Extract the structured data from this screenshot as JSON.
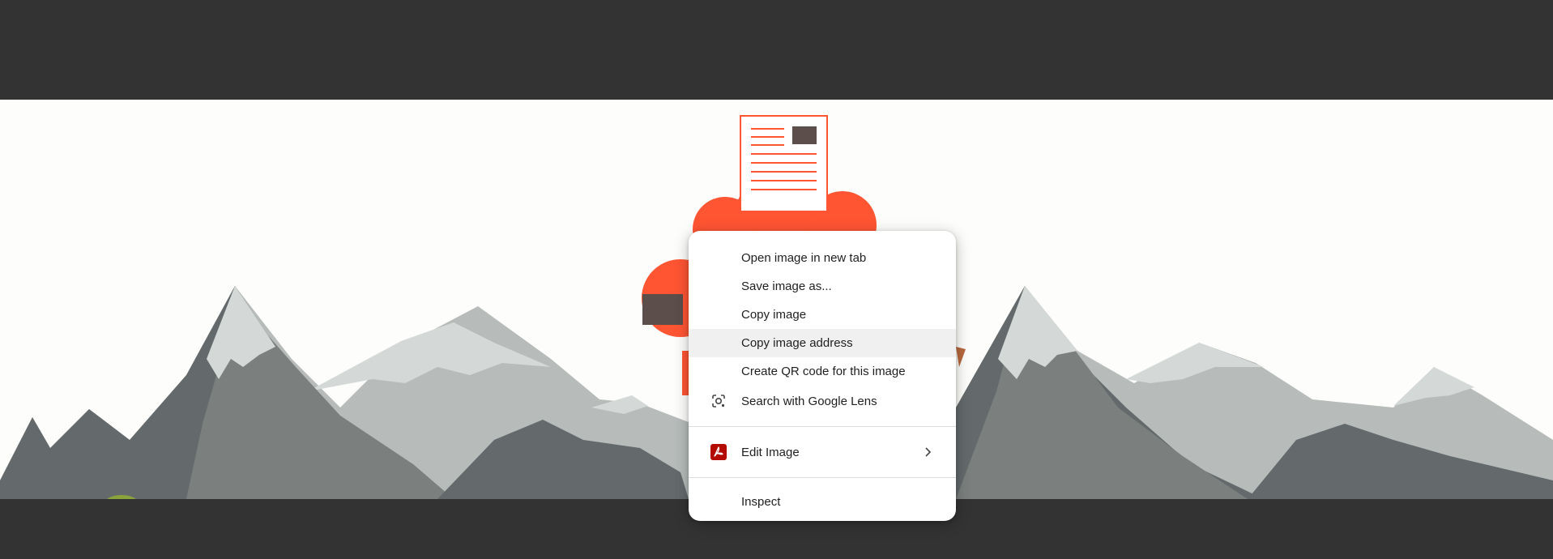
{
  "context_menu": {
    "items": [
      {
        "label": "Open image in new tab",
        "icon": null
      },
      {
        "label": "Save image as...",
        "icon": null
      },
      {
        "label": "Copy image",
        "icon": null
      },
      {
        "label": "Copy image address",
        "icon": null,
        "highlighted": true
      },
      {
        "label": "Create QR code for this image",
        "icon": null
      },
      {
        "label": "Search with Google Lens",
        "icon": "google-lens-icon"
      },
      {
        "label": "Edit Image",
        "icon": "acrobat-pdf-icon",
        "submenu": true
      },
      {
        "label": "Inspect",
        "icon": null
      }
    ]
  },
  "colors": {
    "page_background": "#333333",
    "image_background": "#fdfdfb",
    "menu_background": "#ffffff",
    "menu_highlight": "#f0f0f0",
    "illustration_accent": "#ff5533",
    "acrobat_red": "#b30b00"
  }
}
